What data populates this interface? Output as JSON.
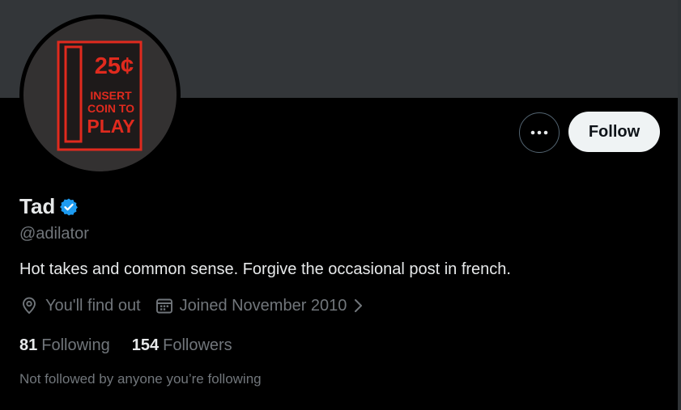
{
  "profile": {
    "display_name": "Tad",
    "handle": "@adilator",
    "bio": "Hot takes and common sense. Forgive the occasional post in french.",
    "location": "You'll find out",
    "joined": "Joined November 2010",
    "following_count": "81",
    "following_label": "Following",
    "followers_count": "154",
    "followers_label": "Followers",
    "not_followed_text": "Not followed by anyone you’re following"
  },
  "avatar_art": {
    "price": "25¢",
    "line1": "INSERT",
    "line2": "COIN TO",
    "line3": "PLAY"
  },
  "actions": {
    "follow_label": "Follow"
  },
  "icons": {
    "more": "more-dots-icon",
    "verified": "verified-badge-icon",
    "location": "location-pin-icon",
    "calendar": "calendar-icon",
    "chevron": "chevron-right-icon"
  },
  "colors": {
    "background": "#000000",
    "banner": "#333639",
    "verified": "#1d9bf0",
    "follow_bg": "#eff3f4",
    "secondary_text": "#71767b",
    "avatar_red": "#e02a1e"
  }
}
